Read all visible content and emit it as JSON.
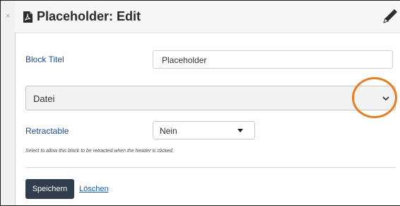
{
  "header": {
    "title": "Placeholder: Edit",
    "icon": "pdf-file-icon",
    "edit_icon": "pencil-icon"
  },
  "close_glyph": "×",
  "form": {
    "block_titel": {
      "label": "Block Titel",
      "value": "Placeholder"
    },
    "datei": {
      "value": "Datei",
      "icon": "chevron-down-icon",
      "highlight_color": "#e67e22"
    },
    "retractable": {
      "label": "Retractable",
      "value": "Nein",
      "icon": "caret-down-icon"
    },
    "hint": "Select to allow this block to be retracted when the header is clicked."
  },
  "actions": {
    "save_label": "Speichern",
    "delete_label": "Löschen"
  }
}
